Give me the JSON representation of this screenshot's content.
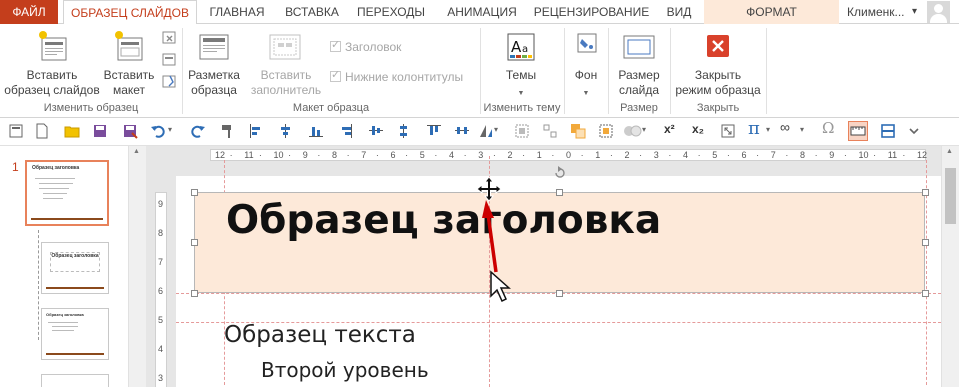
{
  "tabs": {
    "file": "ФАЙЛ",
    "slide_master": "ОБРАЗЕЦ СЛАЙДОВ",
    "home": "ГЛАВНАЯ",
    "insert": "ВСТАВКА",
    "transitions": "ПЕРЕХОДЫ",
    "animations": "АНИМАЦИЯ",
    "review": "РЕЦЕНЗИРОВАНИЕ",
    "view": "ВИД",
    "format": "ФОРМАТ"
  },
  "user": {
    "name": "Клименк...",
    "caret": "▾"
  },
  "ribbon": {
    "insert_master_l1": "Вставить",
    "insert_master_l2": "образец слайдов",
    "insert_layout_l1": "Вставить",
    "insert_layout_l2": "макет",
    "group_edit_master": "Изменить образец",
    "master_layout_l1": "Разметка",
    "master_layout_l2": "образца",
    "insert_placeholder_l1": "Вставить",
    "insert_placeholder_l2": "заполнитель",
    "chk_title": "Заголовок",
    "chk_footers": "Нижние колонтитулы",
    "group_master_layout": "Макет образца",
    "themes": "Темы",
    "group_edit_theme": "Изменить тему",
    "background": "Фон",
    "slide_size_l1": "Размер",
    "slide_size_l2": "слайда",
    "group_size": "Размер",
    "close_l1": "Закрыть",
    "close_l2": "режим образца",
    "group_close": "Закрыть"
  },
  "thumbnails": {
    "index": "1",
    "t1_title": "Образец заголовка",
    "t2_title": "Образец заголовка",
    "t3_title": "Образец заголовка"
  },
  "ruler": {
    "h": [
      "12",
      "11",
      "10",
      "9",
      "8",
      "7",
      "6",
      "5",
      "4",
      "3",
      "2",
      "1",
      "0",
      "1",
      "2",
      "3",
      "4",
      "5",
      "6",
      "7",
      "8",
      "9",
      "10",
      "11",
      "12"
    ],
    "v": [
      "9",
      "8",
      "7",
      "6",
      "5",
      "4",
      "3"
    ]
  },
  "slide": {
    "title": "Образец заголовка",
    "body_level1": "Образец текста",
    "body_level2": "Второй уровень"
  },
  "colors": {
    "accent": "#c43e1c",
    "format_tab": "#fde9d9",
    "title_fill": "#fde9d9",
    "arrow": "#cc0000"
  }
}
